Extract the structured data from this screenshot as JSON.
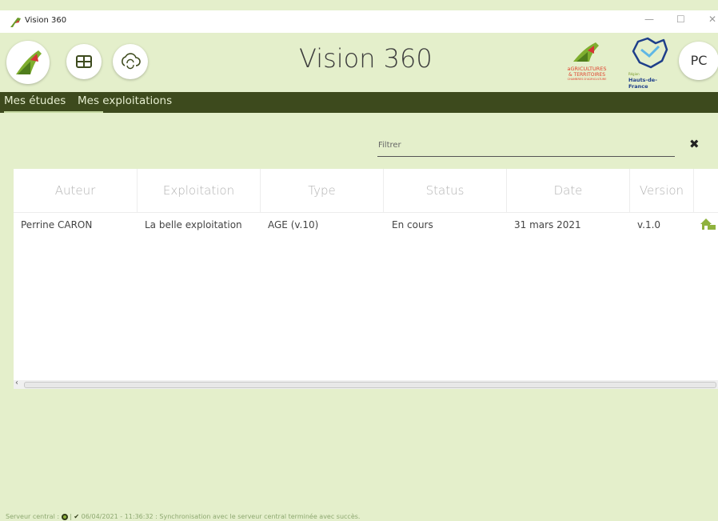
{
  "window": {
    "title": "Vision 360",
    "minimize": "—",
    "maximize": "☐",
    "close": "✕"
  },
  "header": {
    "title": "Vision 360",
    "avatar_initials": "PC",
    "partner_logos": [
      {
        "line1": "aGRICULTURES",
        "line2": "& TERRITOIRES",
        "line3": "CHAMBRES D'AGRICULTURE"
      },
      {
        "line1": "Région",
        "line2": "Hauts-de-France"
      }
    ]
  },
  "nav": {
    "tabs": [
      {
        "label": "Mes études",
        "active": true
      },
      {
        "label": "Mes exploitations",
        "active": false
      }
    ]
  },
  "filter": {
    "placeholder": "Filtrer",
    "value": "",
    "clear": "✖"
  },
  "table": {
    "columns": [
      "Auteur",
      "Exploitation",
      "Type",
      "Status",
      "Date",
      "Version"
    ],
    "rows": [
      {
        "auteur": "Perrine CARON",
        "exploitation": "La belle exploitation",
        "type": "AGE (v.10)",
        "status": "En cours",
        "date": "31 mars 2021",
        "version": "v.1.0",
        "action_icon": "farm-house-icon"
      }
    ]
  },
  "statusbar": {
    "label": "Serveur central :",
    "separator": "|",
    "message": "06/04/2021 - 11:36:32 : Synchronisation avec le serveur central terminée avec succès."
  },
  "colors": {
    "background": "#e4efcb",
    "navbar": "#3d4a1d",
    "accent": "#8fb23d"
  }
}
